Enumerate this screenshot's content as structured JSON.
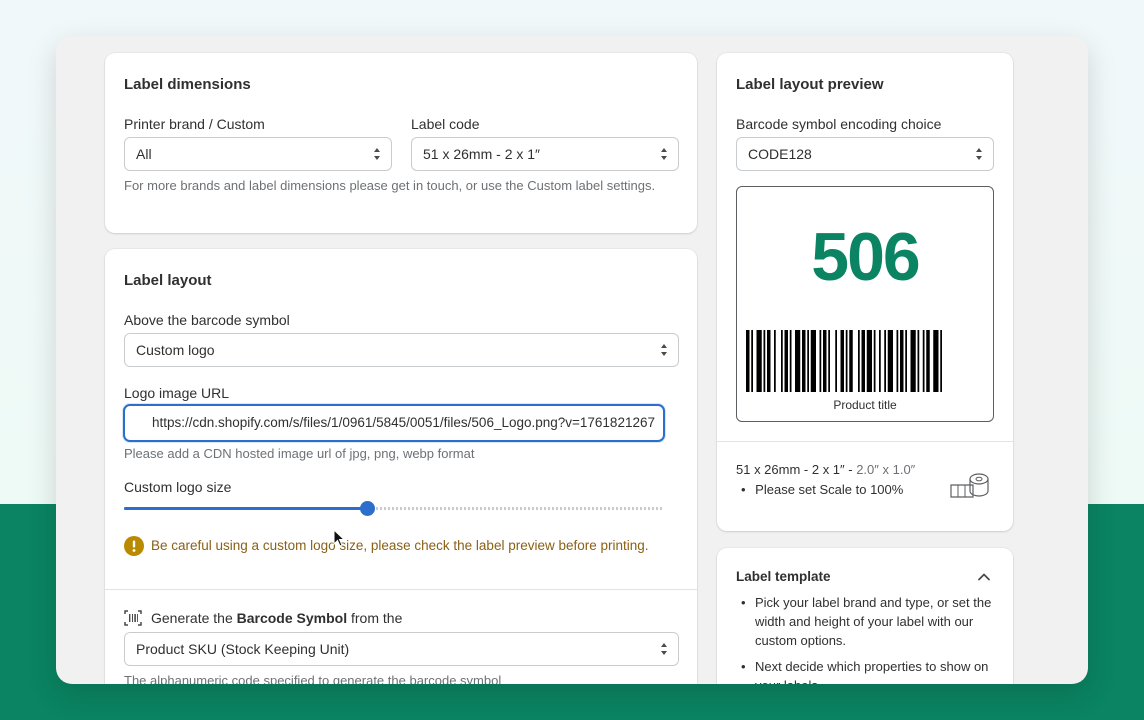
{
  "dimensions": {
    "title": "Label dimensions",
    "printer_label": "Printer brand / Custom",
    "printer_value": "All",
    "code_label": "Label code",
    "code_value": "51 x 26mm - 2 x 1″",
    "help": "For more brands and label dimensions please get in touch, or use the Custom label settings."
  },
  "layout": {
    "title": "Label layout",
    "above_label": "Above the barcode symbol",
    "above_value": "Custom logo",
    "url_label": "Logo image URL",
    "url_value": "https://cdn.shopify.com/s/files/1/0961/5845/0051/files/506_Logo.png?v=1761821267",
    "url_help": "Please add a CDN hosted image url of jpg, png, webp format",
    "size_label": "Custom logo size",
    "size_value": 0.45,
    "warning": "Be careful using a custom logo size, please check the label preview before printing.",
    "generate_prefix": "Generate the ",
    "generate_bold": "Barcode Symbol",
    "generate_suffix": " from the",
    "source_value": "Product SKU (Stock Keeping Unit)",
    "source_help": "The alphanumeric code specified to generate the barcode symbol"
  },
  "preview": {
    "title": "Label layout preview",
    "encoding_label": "Barcode symbol encoding choice",
    "encoding_value": "CODE128",
    "logo_text": "506",
    "product_title": "Product title",
    "size_main": "51 x 26mm - 2 x 1″ - ",
    "size_inches": "2.0″ x 1.0″",
    "scale_note": "Please set Scale to 100%"
  },
  "template": {
    "title": "Label template",
    "steps": [
      "Pick your label brand and type, or set the width and height of your label with our custom options.",
      "Next decide which properties to show on your labels."
    ]
  },
  "colors": {
    "brand_green": "#0a8462",
    "slider_blue": "#2c6ecb",
    "warning_text": "#8a6116",
    "warning_icon": "#b98900"
  },
  "icons": {
    "select_arrows": "up-down-arrows-icon",
    "warning": "warning-icon",
    "barcode": "barcode-icon",
    "label_roll": "label-roll-icon",
    "collapse": "chevron-up-icon"
  }
}
